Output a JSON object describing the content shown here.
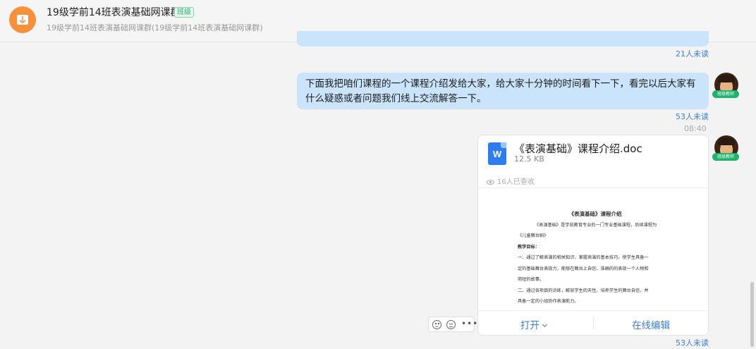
{
  "header": {
    "title": "19级学前14班表演基础网课群",
    "badge": "班级",
    "subtitle": "19级学前14班表演基础网课群(19级学前14班表演基础网课群)"
  },
  "messages": {
    "prev_read_count": "21人未读",
    "text_message": {
      "text": "下面我把咱们课程的一个课程介绍发给大家，给大家十分钟的时间看下一下，看完以后大家有什么疑惑或者问题我们线上交流解答一下。",
      "read_count": "53人未读"
    },
    "time": "08:40",
    "sender_role": "班级教师",
    "file_message": {
      "icon_letter": "W",
      "file_name": "《表演基础》课程介绍.doc",
      "file_size": "12.5 KB",
      "views": "16人已查收",
      "preview": {
        "title": "《表演基础》课程介绍",
        "lines": [
          "《表演基础》是学前教育专业的一门专业基础课程，后续课程为",
          "《儿童舞台剧》",
          "教学目标：",
          "一、通过了解表演的相关知识，掌握表演的基本技巧，使学生具备一",
          "定的基础舞台表现力，能够在舞台上自信、准确的的表现一个人物和",
          "简短的故事。",
          "二、通过各项目的训练，解放学生的天性，培养学生的舞台自信，并",
          "具备一定的小组协作表演能力。"
        ]
      },
      "open_label": "打开",
      "edit_label": "在线编辑",
      "read_count": "53人未读"
    }
  },
  "colors": {
    "bubble": "#c9e4fb",
    "accent": "#3b7ddb",
    "group_avatar": "#f6913a",
    "badge_green": "#27b36a"
  }
}
